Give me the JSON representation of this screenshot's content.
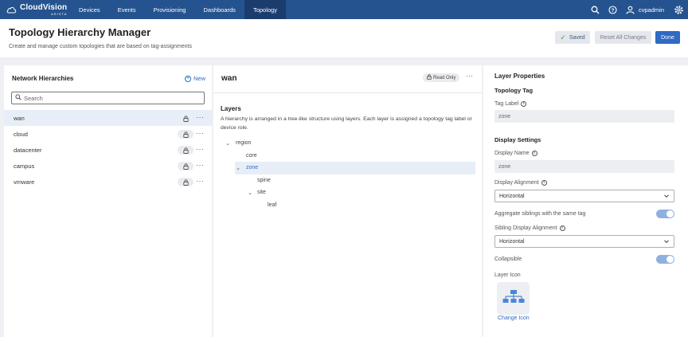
{
  "app": {
    "brand": "CloudVision",
    "brand_sub": "ARISTA"
  },
  "nav": {
    "tabs": [
      {
        "label": "Devices",
        "active": false
      },
      {
        "label": "Events",
        "active": false
      },
      {
        "label": "Provisioning",
        "active": false
      },
      {
        "label": "Dashboards",
        "active": false
      },
      {
        "label": "Topology",
        "active": true
      }
    ],
    "username": "cvpadmin",
    "icons": [
      "search-icon",
      "help-icon",
      "user-icon",
      "settings-gear-icon"
    ]
  },
  "header": {
    "title": "Topology Hierarchy Manager",
    "subtitle": "Create and manage custom topologies that are based on tag-assignments",
    "saved_label": "Saved",
    "reset_label": "Reset All Changes",
    "done_label": "Done"
  },
  "left": {
    "title": "Network Hierarchies",
    "new_label": "New",
    "search_placeholder": "Search",
    "items": [
      {
        "label": "wan",
        "selected": true
      },
      {
        "label": "cloud",
        "selected": false
      },
      {
        "label": "datacenter",
        "selected": false
      },
      {
        "label": "campus",
        "selected": false
      },
      {
        "label": "vmware",
        "selected": false
      }
    ]
  },
  "middle": {
    "title": "wan",
    "read_only_label": "Read Only",
    "layers_title": "Layers",
    "layers_desc": "A hierarchy is arranged in a tree-like structure using layers. Each layer is assigned a topology tag label or device role.",
    "tree": [
      {
        "label": "region",
        "depth": 0,
        "expanded": true,
        "selected": false
      },
      {
        "label": "core",
        "depth": 1,
        "expanded": null,
        "selected": false
      },
      {
        "label": "zone",
        "depth": 1,
        "expanded": true,
        "selected": true
      },
      {
        "label": "spine",
        "depth": 2,
        "expanded": null,
        "selected": false
      },
      {
        "label": "site",
        "depth": 2,
        "expanded": true,
        "selected": false
      },
      {
        "label": "leaf",
        "depth": 3,
        "expanded": null,
        "selected": false
      }
    ]
  },
  "right": {
    "title": "Layer Properties",
    "topology_tag_heading": "Topology Tag",
    "tag_label_label": "Tag Label",
    "tag_label_value": "zone",
    "display_settings_heading": "Display Settings",
    "display_name_label": "Display Name",
    "display_name_value": "zone",
    "display_alignment_label": "Display Alignment",
    "display_alignment_value": "Horizontal",
    "aggregate_label": "Aggregate siblings with the same tag",
    "aggregate_on": true,
    "sibling_alignment_label": "Sibling Display Alignment",
    "sibling_alignment_value": "Horizontal",
    "collapsible_label": "Collapsible",
    "collapsible_on": true,
    "layer_icon_label": "Layer Icon",
    "change_icon_label": "Change Icon"
  },
  "colors": {
    "nav_bg": "#25538f",
    "nav_active": "#1b3d6e",
    "primary": "#2f6ac4",
    "selected_row": "#e8eef7",
    "toggle_on": "#8fb1e0"
  }
}
